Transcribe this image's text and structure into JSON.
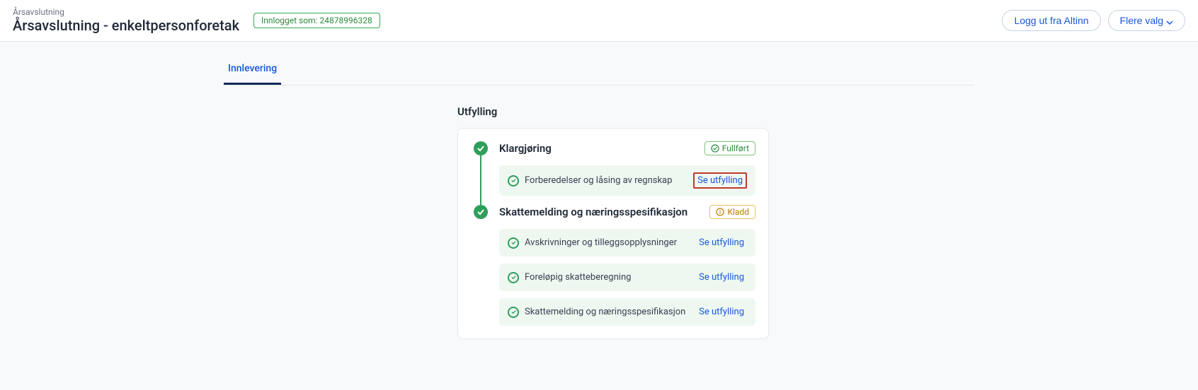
{
  "header": {
    "breadcrumb": "Årsavslutning",
    "page_title": "Årsavslutning - enkeltpersonforetak",
    "login_badge": "Innlogget som: 24878996328",
    "logout_label": "Logg ut fra Altinn",
    "more_label": "Flere valg"
  },
  "tabs": {
    "active": "Innlevering"
  },
  "section": {
    "title": "Utfylling"
  },
  "steps": [
    {
      "title": "Klargjøring",
      "status_label": "Fullført",
      "status_type": "complete",
      "tasks": [
        {
          "label": "Forberedelser og låsing av regnskap",
          "action": "Se utfylling",
          "highlighted": true
        }
      ]
    },
    {
      "title": "Skattemelding og næringsspesifikasjon",
      "status_label": "Kladd",
      "status_type": "draft",
      "tasks": [
        {
          "label": "Avskrivninger og tilleggsopplysninger",
          "action": "Se utfylling",
          "highlighted": false
        },
        {
          "label": "Foreløpig skatteberegning",
          "action": "Se utfylling",
          "highlighted": false
        },
        {
          "label": "Skattemelding og næringsspesifikasjon",
          "action": "Se utfylling",
          "highlighted": false
        }
      ]
    }
  ]
}
